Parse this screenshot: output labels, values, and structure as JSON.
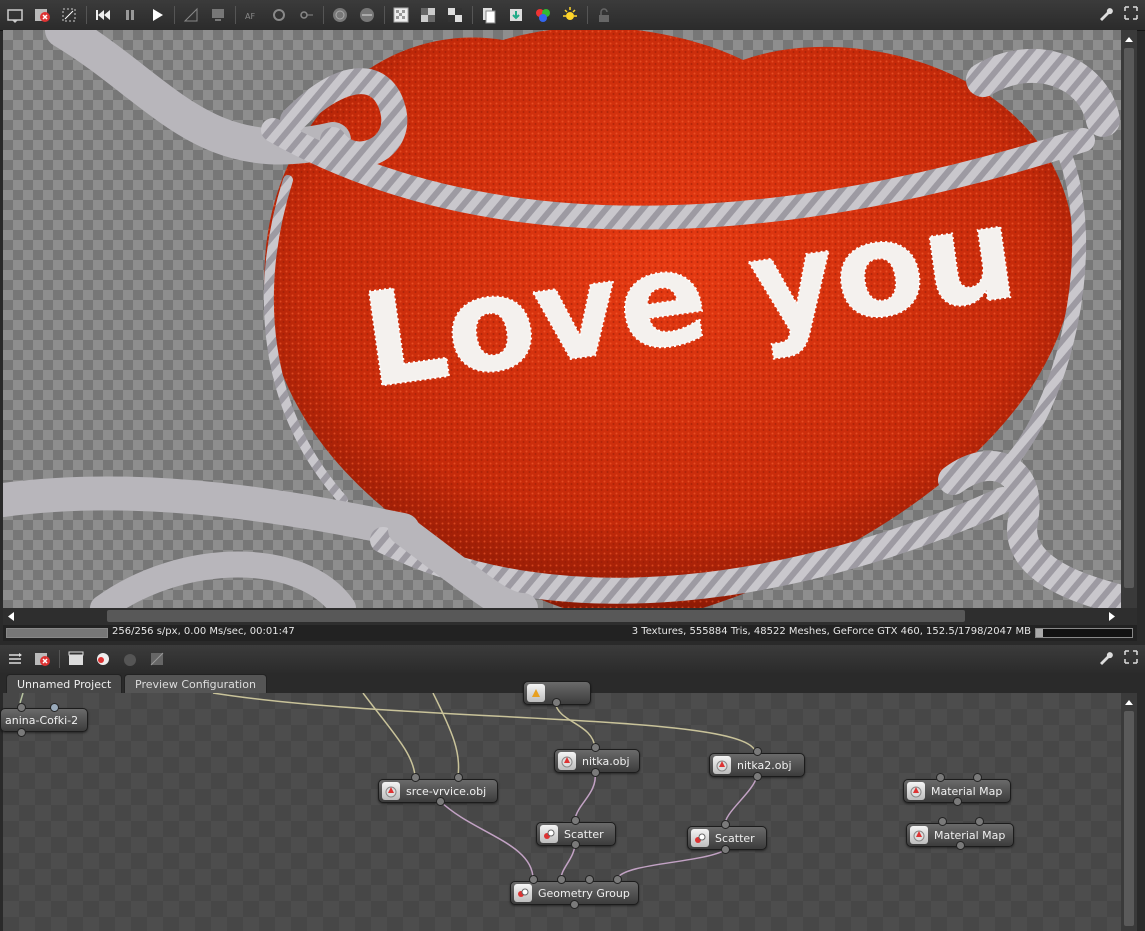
{
  "render_view": {
    "toolbar_icons": [
      "screenshot-icon",
      "cancel-render-icon",
      "fit-icon",
      "rewind-icon",
      "pause-icon",
      "play-icon",
      "ruler-icon",
      "monitor-icon",
      "aperture-icon",
      "refresh-icon",
      "focus-icon",
      "sphere-icon",
      "sphere-alt-icon",
      "checker-icon",
      "checker-alt-icon",
      "checker-dark-icon",
      "copy-icon",
      "export-icon",
      "color-picker-icon",
      "light-icon",
      "lock-icon"
    ],
    "scene_text": "Love you"
  },
  "status": {
    "left": "256/256 s/px, 0.00 Ms/sec, 00:01:47",
    "right": "3 Textures, 555884 Tris, 48522 Meshes, GeForce GTX 460, 152.5/1798/2047 MB",
    "render_progress": 1.0,
    "gpu_memory_fraction": 0.07
  },
  "graph_editor": {
    "tabs": [
      {
        "label": "Unnamed Project",
        "active": true
      },
      {
        "label": "Preview Configuration",
        "active": false
      }
    ],
    "nodes": [
      {
        "id": "n1",
        "label": "anina-Cofki-2"
      },
      {
        "id": "n2",
        "label": "srce-vrvice.obj"
      },
      {
        "id": "n3",
        "label": "nitka.obj"
      },
      {
        "id": "n4",
        "label": "nitka2.obj"
      },
      {
        "id": "n5",
        "label": "Scatter"
      },
      {
        "id": "n6",
        "label": "Scatter"
      },
      {
        "id": "n7",
        "label": "Geometry Group"
      },
      {
        "id": "n8",
        "label": "Material Map"
      },
      {
        "id": "n9",
        "label": "Material Map"
      }
    ]
  }
}
